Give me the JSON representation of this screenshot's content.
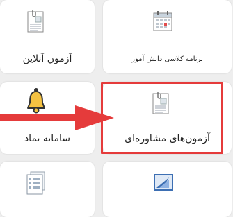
{
  "tiles": [
    {
      "label": "برنامه کلاسی دانش آموز",
      "icon": "calendar-icon"
    },
    {
      "label": "آزمون آنلاین",
      "icon": "document-icon"
    },
    {
      "label": "آزمون‌های مشاوره‌ای",
      "icon": "document-icon"
    },
    {
      "label": "سامانه نماد",
      "icon": "bell-icon"
    },
    {
      "label": "",
      "icon": "presentation-icon"
    },
    {
      "label": "",
      "icon": "list-icon"
    }
  ],
  "colors": {
    "highlight": "#e53b3b",
    "arrow": "#e53b3b",
    "bell": "#f5c242"
  }
}
